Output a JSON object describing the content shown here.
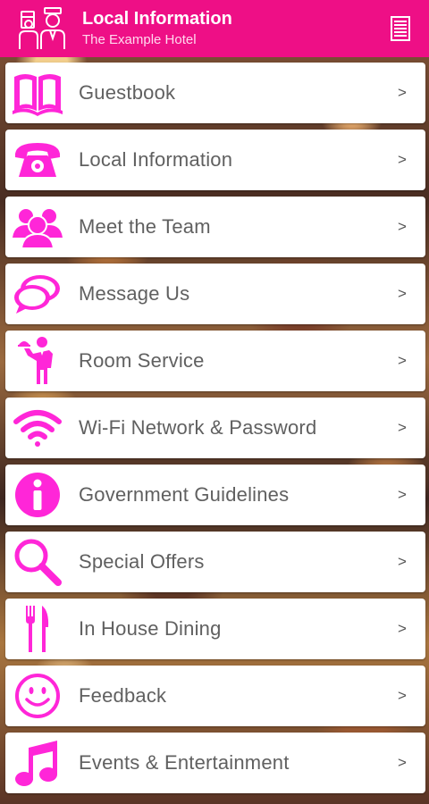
{
  "header": {
    "title": "Local Information",
    "subtitle": "The Example Hotel",
    "logo_icon": "concierge-logo-icon",
    "menu_icon": "menu-icon"
  },
  "colors": {
    "accent": "#ee0f86",
    "icon": "#ff26d8",
    "item_bg": "#ffffff",
    "label": "#606060"
  },
  "items": [
    {
      "label": "Guestbook",
      "icon": "book-icon",
      "chevron": ">"
    },
    {
      "label": "Local Information",
      "icon": "telephone-icon",
      "chevron": ">"
    },
    {
      "label": "Meet the Team",
      "icon": "people-icon",
      "chevron": ">"
    },
    {
      "label": "Message Us",
      "icon": "chat-bubble-icon",
      "chevron": ">"
    },
    {
      "label": "Room Service",
      "icon": "waiter-icon",
      "chevron": ">"
    },
    {
      "label": "Wi-Fi Network & Password",
      "icon": "wifi-icon",
      "chevron": ">"
    },
    {
      "label": "Government Guidelines",
      "icon": "info-icon",
      "chevron": ">"
    },
    {
      "label": "Special Offers",
      "icon": "magnifier-icon",
      "chevron": ">"
    },
    {
      "label": "In House Dining",
      "icon": "fork-knife-icon",
      "chevron": ">"
    },
    {
      "label": "Feedback",
      "icon": "smiley-icon",
      "chevron": ">"
    },
    {
      "label": "Events & Entertainment",
      "icon": "music-note-icon",
      "chevron": ">"
    }
  ]
}
